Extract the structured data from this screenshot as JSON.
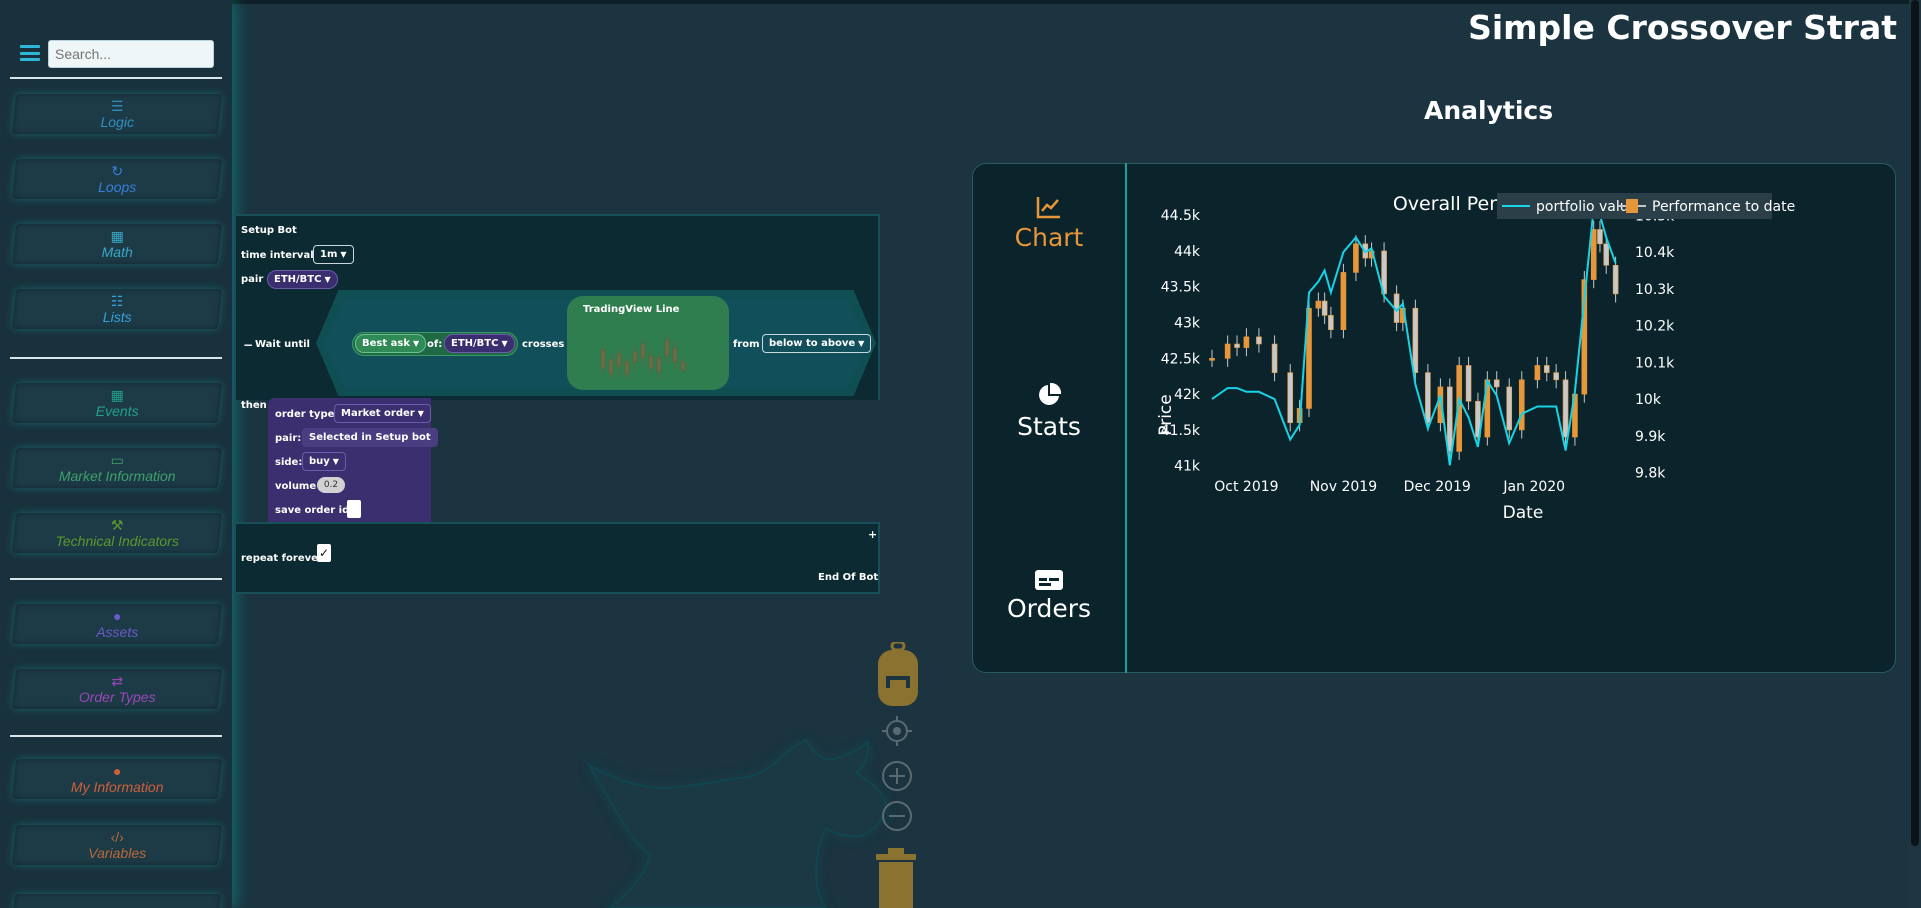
{
  "app": {
    "title": "Simple Crossover Strat"
  },
  "sidebar": {
    "search_placeholder": "Search...",
    "categories": [
      {
        "label": "Logic",
        "icon": "logic-icon",
        "color": "#2f8fc0"
      },
      {
        "label": "Loops",
        "icon": "loop-icon",
        "color": "#3a7fd8"
      },
      {
        "label": "Math",
        "icon": "calculator-icon",
        "color": "#3aa8c8"
      },
      {
        "label": "Lists",
        "icon": "list-icon",
        "color": "#3aa0d8"
      },
      {
        "label": "Events",
        "icon": "calendar-icon",
        "color": "#22a08a"
      },
      {
        "label": "Market Information",
        "icon": "chart-line-icon",
        "color": "#3fa06a"
      },
      {
        "label": "Technical Indicators",
        "icon": "wrench-icon",
        "color": "#5a9a2a"
      },
      {
        "label": "Assets",
        "icon": "bitcoin-icon",
        "color": "#6a5cc8"
      },
      {
        "label": "Order Types",
        "icon": "exchange-icon",
        "color": "#9a48b8"
      },
      {
        "label": "My Information",
        "icon": "user-icon",
        "color": "#d0603a"
      },
      {
        "label": "Variables",
        "icon": "code-icon",
        "color": "#b86a3a"
      }
    ]
  },
  "workspace": {
    "setup": {
      "title": "Setup Bot",
      "time_interval_label": "time interval",
      "time_interval_value": "1m",
      "pair_label": "pair",
      "pair_value": "ETH/BTC"
    },
    "wait": {
      "minus": "−",
      "label": "Wait until",
      "price_value": "Best ask",
      "of_label": "of:",
      "of_value": "ETH/BTC",
      "crosses_label": "crosses",
      "tv_title": "TradingView Line",
      "from_label": "from",
      "from_value": "below to above"
    },
    "then_label": "then",
    "order": {
      "order_type_label": "order type:",
      "order_type_value": "Market order",
      "pair_label": "pair:",
      "pair_value": "Selected in Setup bot",
      "side_label": "side:",
      "side_value": "buy",
      "volume_label": "volume",
      "volume_value": "0.2",
      "save_order_id_label": "save order id:"
    },
    "repeat_label": "repeat forever",
    "repeat_checked": "✓",
    "plus": "+",
    "end_label": "End Of Bot"
  },
  "tools": [
    "backpack-icon",
    "target-icon",
    "zoom-in-icon",
    "zoom-out-icon",
    "trash-icon"
  ],
  "analytics": {
    "title": "Analytics",
    "tabs": [
      {
        "label": "Chart",
        "icon": "chart-line-icon",
        "active": true,
        "color": "#e8963a"
      },
      {
        "label": "Stats",
        "icon": "pie-chart-icon",
        "active": false,
        "color": "#ffffff"
      },
      {
        "label": "Orders",
        "icon": "card-icon",
        "active": false,
        "color": "#ffffff"
      }
    ]
  },
  "chart_data": {
    "type": "line",
    "title": "Overall Performance",
    "xlabel": "Date",
    "ylabel": "Price",
    "x_ticks": [
      "Oct 2019",
      "Nov 2019",
      "Dec 2019",
      "Jan 2020"
    ],
    "y_ticks_left": [
      "44.5k",
      "44k",
      "43.5k",
      "43k",
      "42.5k",
      "42k",
      "41.5k",
      "41k"
    ],
    "y_ticks_right": [
      "10.5k",
      "10.4k",
      "10.3k",
      "10.2k",
      "10.1k",
      "10k",
      "9.9k",
      "9.8k"
    ],
    "ylim_left": [
      40800,
      44600
    ],
    "ylim_right": [
      9780,
      10520
    ],
    "legend": [
      "portfolio value",
      "Performance to date"
    ],
    "legend_position": "top-right",
    "grid": false,
    "series": [
      {
        "name": "portfolio value",
        "type": "line",
        "color": "#16d4e6",
        "axis": "right",
        "x": [
          "2019-09-20",
          "2019-09-25",
          "2019-09-28",
          "2019-10-01",
          "2019-10-05",
          "2019-10-10",
          "2019-10-15",
          "2019-10-18",
          "2019-10-21",
          "2019-10-24",
          "2019-10-26",
          "2019-10-28",
          "2019-11-01",
          "2019-11-05",
          "2019-11-08",
          "2019-11-10",
          "2019-11-14",
          "2019-11-18",
          "2019-11-20",
          "2019-11-24",
          "2019-11-28",
          "2019-12-02",
          "2019-12-05",
          "2019-12-08",
          "2019-12-11",
          "2019-12-14",
          "2019-12-17",
          "2019-12-20",
          "2019-12-24",
          "2019-12-28",
          "2020-01-02",
          "2020-01-05",
          "2020-01-08",
          "2020-01-11",
          "2020-01-14",
          "2020-01-17",
          "2020-01-20",
          "2020-01-22",
          "2020-01-24",
          "2020-01-27"
        ],
        "values": [
          10000,
          10030,
          10030,
          10020,
          10020,
          10000,
          9890,
          9930,
          10290,
          10320,
          10350,
          10290,
          10400,
          10440,
          10400,
          10410,
          10280,
          10240,
          10260,
          10040,
          9920,
          10010,
          9820,
          10000,
          9950,
          9870,
          10050,
          10010,
          9880,
          9960,
          9980,
          9980,
          9980,
          9860,
          10020,
          10270,
          10520,
          10500,
          10440,
          10370
        ]
      },
      {
        "name": "Performance to date",
        "type": "candlestick",
        "color": "#e8963a",
        "axis": "left",
        "x": [
          "2019-09-20",
          "2019-09-25",
          "2019-09-28",
          "2019-10-01",
          "2019-10-05",
          "2019-10-10",
          "2019-10-15",
          "2019-10-18",
          "2019-10-21",
          "2019-10-24",
          "2019-10-26",
          "2019-10-28",
          "2019-11-01",
          "2019-11-05",
          "2019-11-08",
          "2019-11-10",
          "2019-11-14",
          "2019-11-18",
          "2019-11-20",
          "2019-11-24",
          "2019-11-28",
          "2019-12-02",
          "2019-12-05",
          "2019-12-08",
          "2019-12-11",
          "2019-12-14",
          "2019-12-17",
          "2019-12-20",
          "2019-12-24",
          "2019-12-28",
          "2020-01-02",
          "2020-01-05",
          "2020-01-08",
          "2020-01-11",
          "2020-01-14",
          "2020-01-17",
          "2020-01-20",
          "2020-01-22",
          "2020-01-24",
          "2020-01-27"
        ],
        "values": [
          42500,
          42700,
          42650,
          42800,
          42700,
          42300,
          41600,
          41800,
          43200,
          43300,
          43100,
          42900,
          43700,
          44100,
          43900,
          44000,
          43400,
          43000,
          43200,
          42300,
          41600,
          42100,
          41200,
          42400,
          41900,
          41400,
          42200,
          42100,
          41500,
          42200,
          42400,
          42300,
          42200,
          41400,
          42000,
          43600,
          44300,
          44100,
          43800,
          43400
        ]
      }
    ]
  }
}
